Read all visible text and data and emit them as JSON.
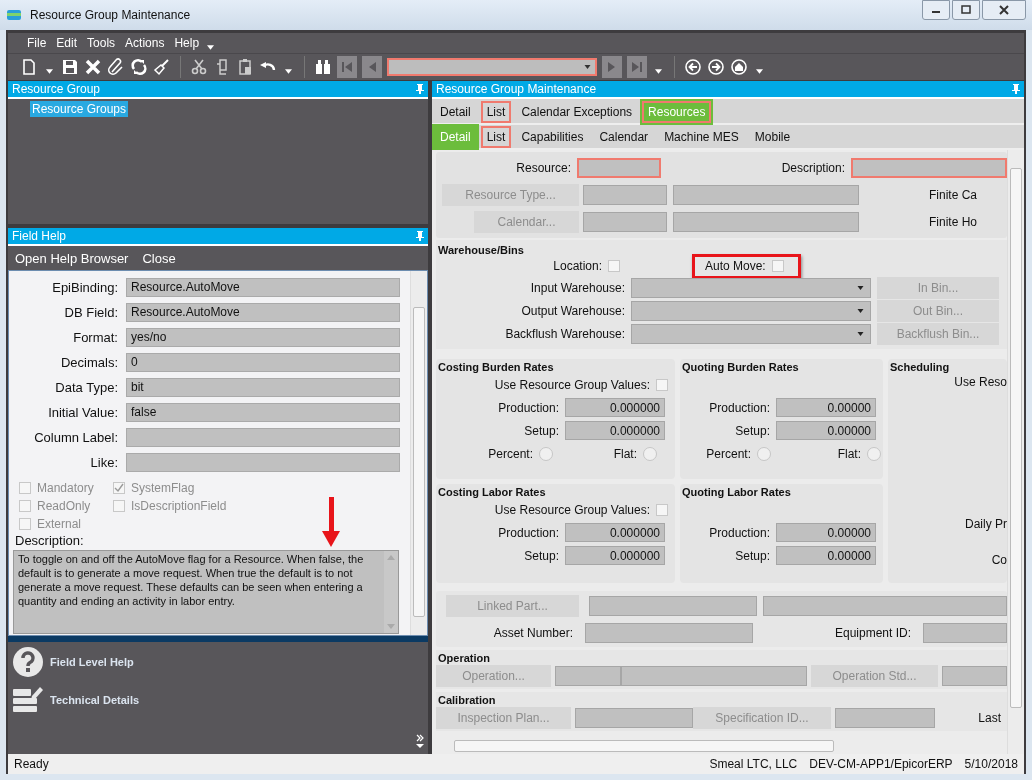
{
  "window": {
    "title": "Resource Group Maintenance"
  },
  "menu": [
    {
      "label": "File"
    },
    {
      "label": "Edit"
    },
    {
      "label": "Tools"
    },
    {
      "label": "Actions"
    },
    {
      "label": "Help"
    }
  ],
  "resource_group_panel": {
    "title": "Resource Group",
    "tree": [
      {
        "label": "Resource Groups",
        "selected": true
      }
    ]
  },
  "field_help": {
    "title": "Field Help",
    "actions": [
      "Open Help Browser",
      "Close"
    ],
    "fields": [
      {
        "label": "EpiBinding:",
        "value": "Resource.AutoMove"
      },
      {
        "label": "DB Field:",
        "value": "Resource.AutoMove"
      },
      {
        "label": "Format:",
        "value": "yes/no"
      },
      {
        "label": "Decimals:",
        "value": "0"
      },
      {
        "label": "Data Type:",
        "value": "bit"
      },
      {
        "label": "Initial Value:",
        "value": "false"
      },
      {
        "label": "Column Label:"
      },
      {
        "label": "Like:"
      }
    ],
    "checkboxes": [
      {
        "label": "Mandatory",
        "checked": false,
        "disabled": true
      },
      {
        "label": "SystemFlag",
        "checked": true,
        "disabled": true
      },
      {
        "label": "ReadOnly",
        "checked": false,
        "disabled": true
      },
      {
        "label": "IsDescriptionField",
        "checked": false,
        "disabled": true
      },
      {
        "label": "External",
        "checked": false,
        "disabled": true
      }
    ],
    "description_label": "Description:",
    "description": "To toggle on and off the AutoMove flag for a Resource.  When false, the default is to generate a move request.  When true the default is to not generate a move request.  These defaults can be seen when entering a quantity and ending an activity in labor entry."
  },
  "help_links": [
    {
      "label": "Field Level Help",
      "kind": "help"
    },
    {
      "label": "Technical Details",
      "kind": "technical"
    }
  ],
  "main": {
    "title": "Resource Group Maintenance",
    "tabs": [
      {
        "label": "Detail",
        "selected": false,
        "flagged": false
      },
      {
        "label": "List",
        "selected": false,
        "flagged": true
      },
      {
        "label": "Calendar Exceptions",
        "selected": false,
        "flagged": false
      },
      {
        "label": "Resources",
        "selected": true,
        "flagged": true
      }
    ],
    "subtabs": [
      {
        "label": "Detail",
        "selected": true,
        "flagged": false
      },
      {
        "label": "List",
        "selected": false,
        "flagged": true
      },
      {
        "label": "Capabilities",
        "selected": false,
        "flagged": false
      },
      {
        "label": "Calendar",
        "selected": false,
        "flagged": false
      },
      {
        "label": "Machine MES",
        "selected": false,
        "flagged": false
      },
      {
        "label": "Mobile",
        "selected": false,
        "flagged": false
      }
    ]
  },
  "form": {
    "resource": {
      "label": "Resource:",
      "required": true
    },
    "description": {
      "label": "Description:",
      "required": true
    },
    "resource_type": {
      "label": "Resource Type...",
      "disabled": true
    },
    "finite_capacity": "Finite Ca",
    "calendar": {
      "label": "Calendar...",
      "disabled": true
    },
    "finite_horizon": "Finite Ho",
    "warehouse": {
      "title": "Warehouse/Bins",
      "location": {
        "label": "Location:",
        "checked": false
      },
      "auto_move": {
        "label": "Auto Move:",
        "checked": false,
        "highlighted": true
      },
      "rows": [
        {
          "label": "Input Warehouse:",
          "button": {
            "label": "In Bin...",
            "disabled": true
          }
        },
        {
          "label": "Output Warehouse:",
          "button": {
            "label": "Out Bin...",
            "disabled": true
          }
        },
        {
          "label": "Backflush Warehouse:",
          "button": {
            "label": "Backflush Bin...",
            "disabled": true
          }
        }
      ]
    },
    "rate_groups": [
      {
        "title": "Costing Burden Rates",
        "use_group": {
          "label": "Use Resource Group Values:",
          "checked": false
        },
        "rows": [
          {
            "label": "Production:",
            "value": "0.000000"
          },
          {
            "label": "Setup:",
            "value": "0.000000"
          }
        ],
        "radios": [
          {
            "label": "Percent:",
            "selected": false
          },
          {
            "label": "Flat:",
            "selected": false
          }
        ]
      },
      {
        "title": "Quoting Burden Rates",
        "rows": [
          {
            "label": "Production:",
            "value": "0.00000"
          },
          {
            "label": "Setup:",
            "value": "0.00000"
          }
        ],
        "radios": [
          {
            "label": "Percent:",
            "selected": false
          },
          {
            "label": "Flat:",
            "selected": false
          }
        ]
      },
      {
        "title": "Costing Labor Rates",
        "use_group": {
          "label": "Use Resource Group Values:",
          "checked": false
        },
        "rows": [
          {
            "label": "Production:",
            "value": "0.000000"
          },
          {
            "label": "Setup:",
            "value": "0.000000"
          }
        ]
      },
      {
        "title": "Quoting Labor Rates",
        "rows": [
          {
            "label": "Production:",
            "value": "0.00000"
          },
          {
            "label": "Setup:",
            "value": "0.00000"
          }
        ]
      }
    ],
    "scheduling": {
      "title": "Scheduling",
      "texts": [
        "Use Reso",
        "Daily Pr",
        "Co"
      ]
    },
    "linked_part": {
      "label": "Linked Part...",
      "disabled": true
    },
    "asset_number": "Asset Number:",
    "equipment_id": "Equipment ID:",
    "operation": {
      "title": "Operation",
      "buttons": [
        {
          "label": "Operation...",
          "disabled": true
        },
        {
          "label": "Operation Std...",
          "disabled": true
        }
      ]
    },
    "calibration": {
      "title": "Calibration",
      "buttons": [
        {
          "label": "Inspection Plan...",
          "disabled": true
        },
        {
          "label": "Specification ID...",
          "disabled": true
        }
      ],
      "last": "Last"
    }
  },
  "status_bar": {
    "status": "Ready",
    "company": "Smeal LTC, LLC",
    "server": "DEV-CM-APP1/EpicorERP",
    "date": "5/10/2018"
  }
}
